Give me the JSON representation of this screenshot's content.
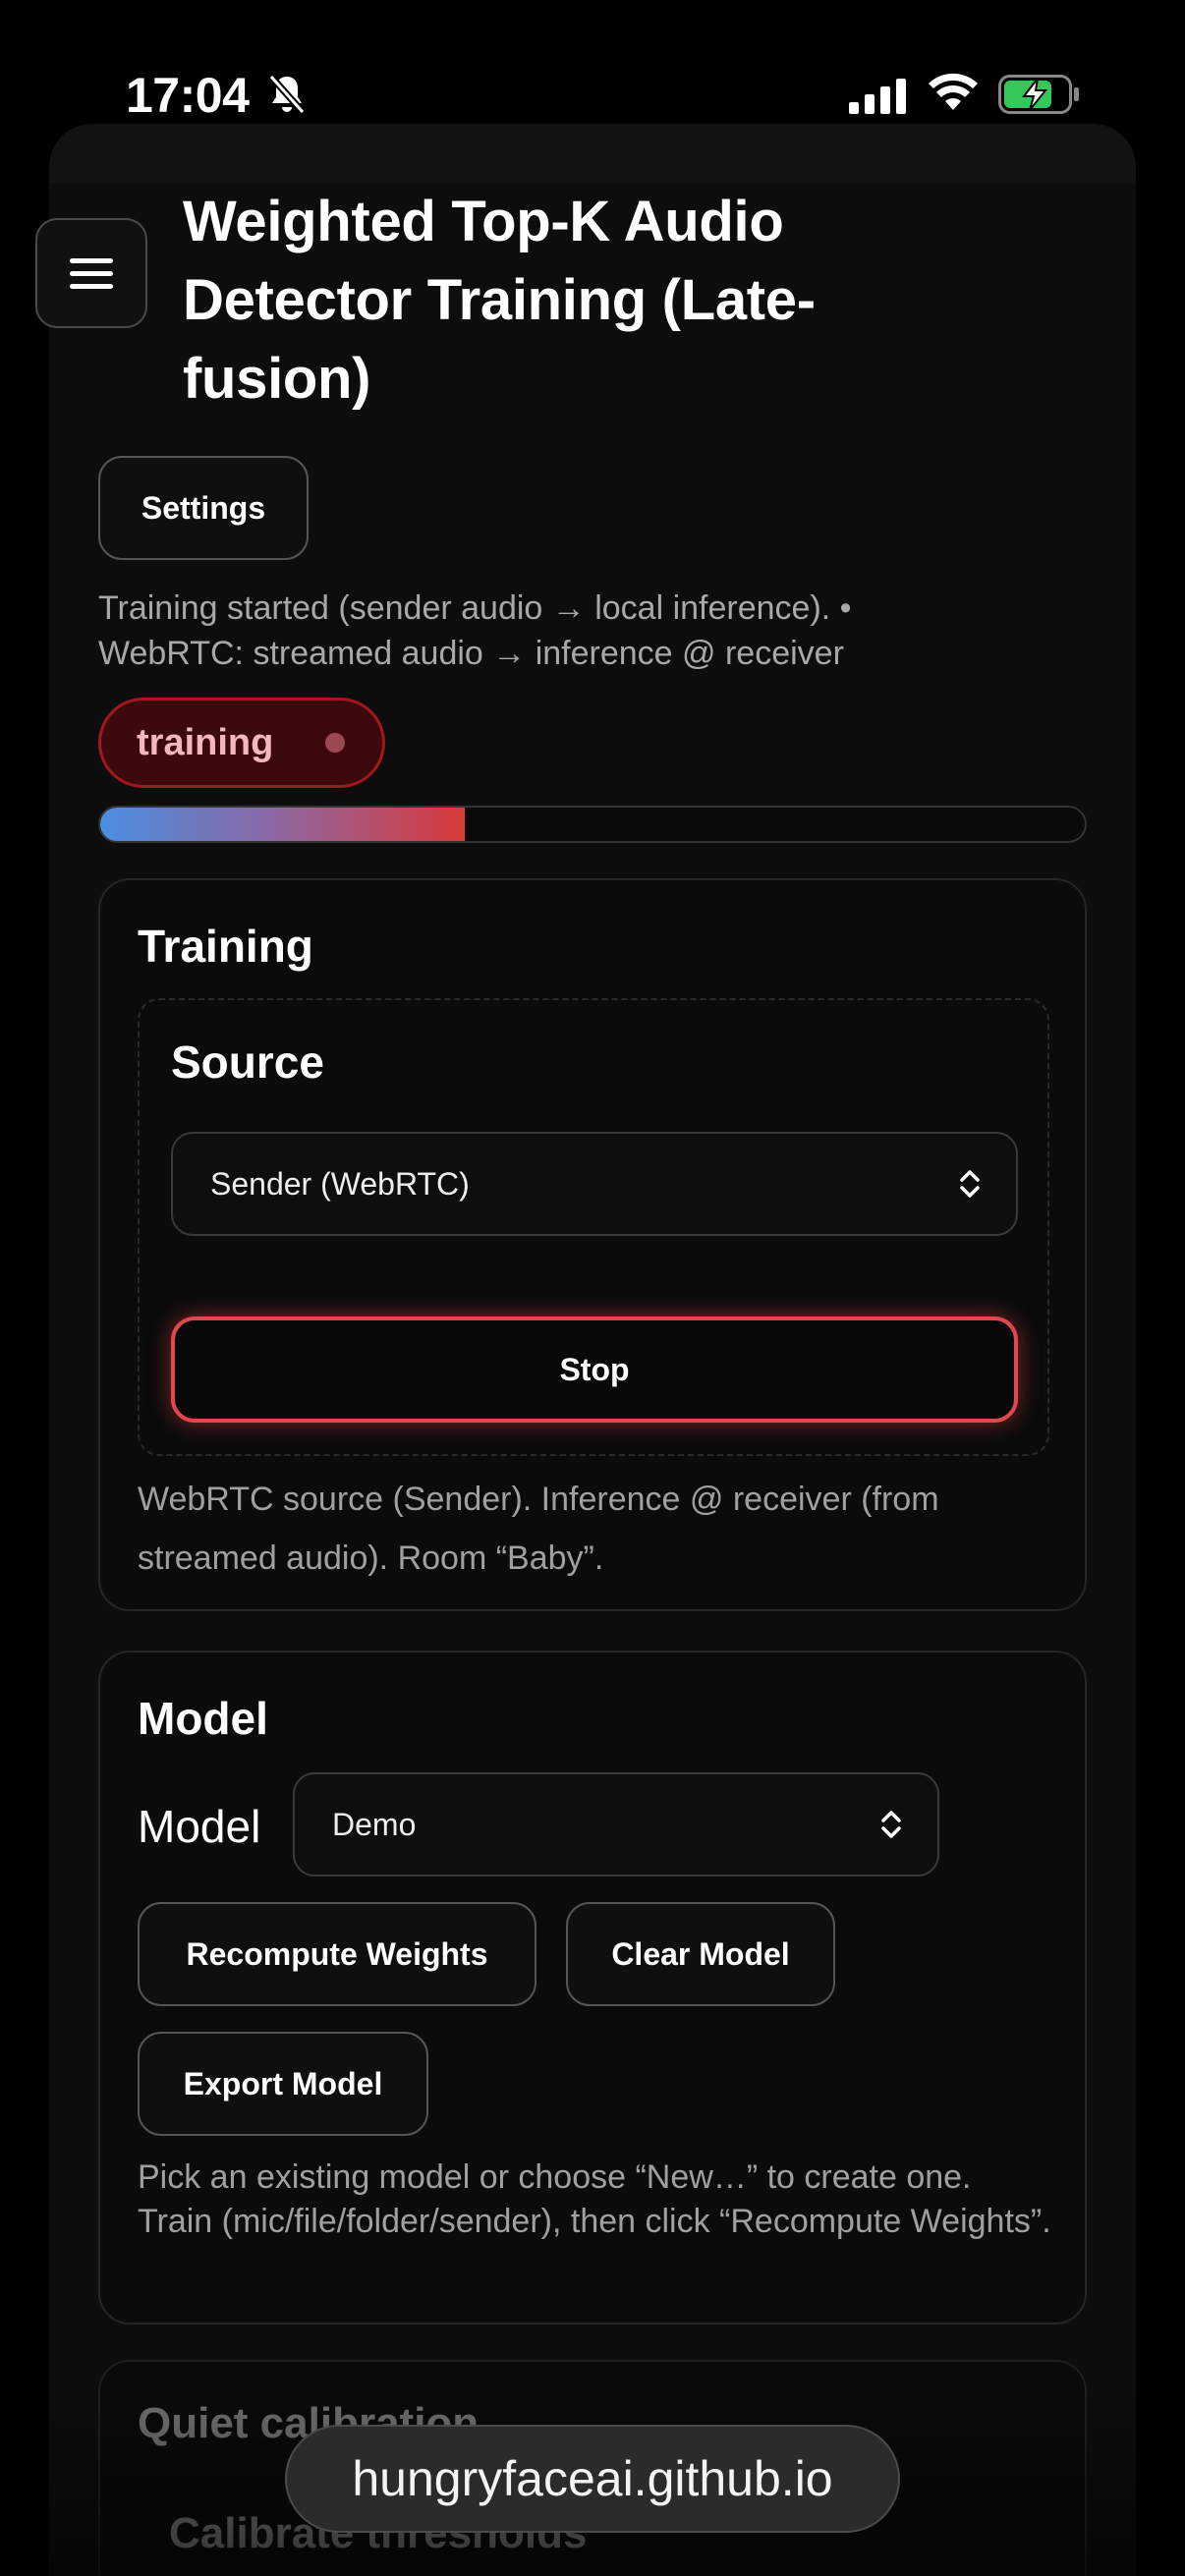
{
  "status_bar": {
    "time": "17:04"
  },
  "header": {
    "title": "Weighted Top-K Audio Detector Training (Late-fusion)"
  },
  "toolbar": {
    "settings_label": "Settings"
  },
  "status": {
    "message": "Training started (sender audio → local inference). • WebRTC: streamed audio → inference @ receiver",
    "pill_label": "training",
    "progress": 0.37
  },
  "training_panel": {
    "title": "Training",
    "source_title": "Source",
    "source_selected": "Sender (WebRTC)",
    "stop_label": "Stop",
    "helper": "WebRTC source (Sender). Inference @ receiver (from streamed audio). Room “Baby”."
  },
  "model_panel": {
    "title": "Model",
    "model_label": "Model",
    "model_selected": "Demo",
    "recompute_label": "Recompute Weights",
    "clear_label": "Clear Model",
    "export_label": "Export Model",
    "helper": "Pick an existing model or choose “New…” to create one. Train (mic/file/folder/sender), then click “Recompute Weights”."
  },
  "quiet_panel": {
    "title": "Quiet calibration",
    "sub_title": "Calibrate thresholds"
  },
  "browser": {
    "url": "hungryfaceai.github.io"
  },
  "colors": {
    "accent_red": "#e0474f",
    "progress_blue": "#4a8ee0",
    "pill_bg": "#3d0a0c"
  }
}
